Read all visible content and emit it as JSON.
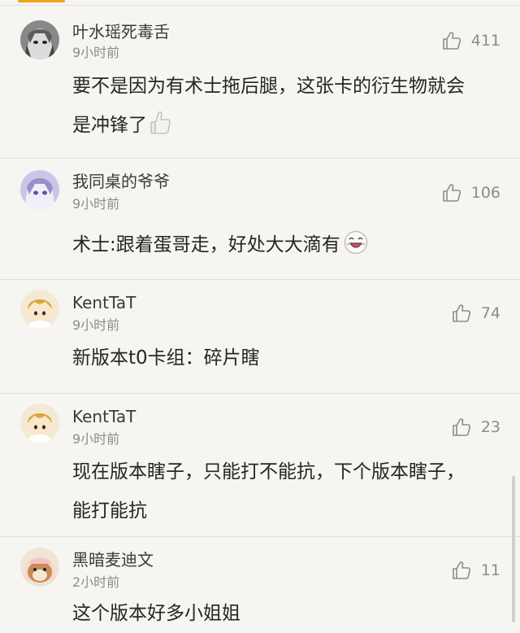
{
  "comments": [
    {
      "username": "叶水瑶死毒舌",
      "time": "9小时前",
      "likes": "411",
      "text_line1": "要不是因为有术士拖后腿，这张卡的衍生物就会",
      "text_line2": "是冲锋了",
      "emoji": "thumbs-up-emoji"
    },
    {
      "username": "我同桌的爷爷",
      "time": "9小时前",
      "likes": "106",
      "text_line1": "术士:跟着蛋哥走，好处大大滴有",
      "emoji": "grinning-face-emoji"
    },
    {
      "username": "KentTaT",
      "time": "9小时前",
      "likes": "74",
      "text_line1": "新版本t0卡组：碎片瞎"
    },
    {
      "username": "KentTaT",
      "time": "9小时前",
      "likes": "23",
      "text_line1": "现在版本瞎子，只能打不能抗，下个版本瞎子，",
      "text_line2": "能打能抗"
    },
    {
      "username": "黑暗麦迪文",
      "time": "2小时前",
      "likes": "11",
      "text_line1": "这个版本好多小姐姐"
    }
  ],
  "icons": {
    "like": "thumbs-up-icon"
  },
  "colors": {
    "accent": "#f4a21d",
    "background": "#f7f5f1",
    "meta_text": "#8c8c8c"
  }
}
